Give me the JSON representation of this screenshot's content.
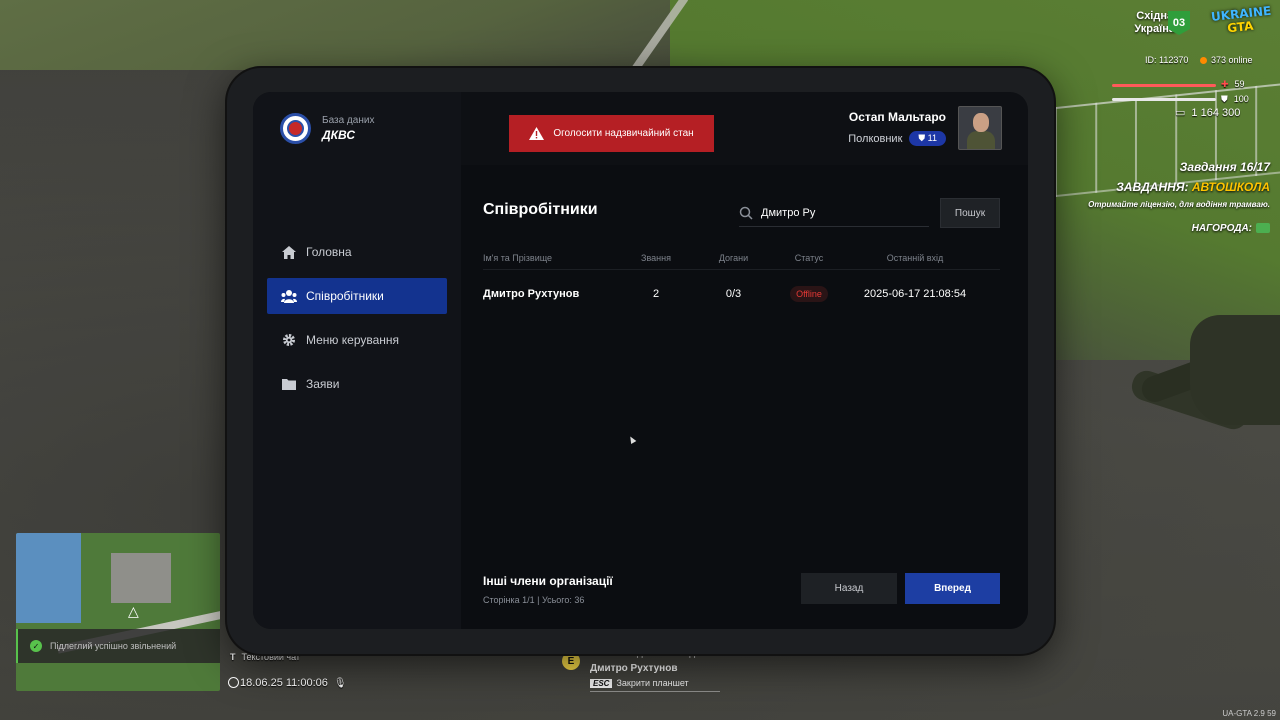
{
  "hud": {
    "region_line1": "Східна",
    "region_line2": "Україна",
    "region_badge": "03",
    "logo_line1": "UKRAINE",
    "logo_line2": "GTA",
    "player_id": "ID: 112370",
    "online": "373 online",
    "health": "59",
    "armor": "100",
    "money": "1 164 300",
    "quest_counter": "Завдання 16/17",
    "quest_prefix": "ЗАВДАННЯ: ",
    "quest_name": "АВТОШКОЛА",
    "quest_desc": "Отримайте ліцензію, для водіння трамваю.",
    "quest_reward": "НАГОРОДА:",
    "accent_color": "#13338f",
    "danger_color": "#b51f24"
  },
  "notifications": {
    "dismissed": "Підлеглий успішно звільнений"
  },
  "chat": {
    "chat_key": "T",
    "chat_label": "Текстовий чат",
    "datetime": "18.06.25 11:00:06"
  },
  "interaction": {
    "key": "E",
    "line1": "Затисніть для взаємодії з",
    "target": "Дмитро Рухтунов",
    "esc_key": "ESC",
    "esc_label": "Закрити планшет"
  },
  "version": "UA-GTA 2.9   59",
  "tablet": {
    "brand_sub": "База даних",
    "brand_name": "ДКВС",
    "emergency_button": "Оголосити надзвичайний стан",
    "user": {
      "name": "Остап Мальтаро",
      "rank": "Полковник",
      "level": "11"
    },
    "nav": [
      {
        "label": "Головна",
        "icon": "home-icon"
      },
      {
        "label": "Співробітники",
        "icon": "users-icon",
        "active": true
      },
      {
        "label": "Меню керування",
        "icon": "gear-icon"
      },
      {
        "label": "Заяви",
        "icon": "folder-icon"
      }
    ],
    "section_title": "Співробітники",
    "search": {
      "value": "Дмитро Ру",
      "button": "Пошук"
    },
    "table": {
      "headers": [
        "Ім'я та Прізвище",
        "Звання",
        "Догани",
        "Статус",
        "Останній вхід"
      ],
      "rows": [
        {
          "name": "Дмитро Рухтунов",
          "rank": "2",
          "warnings": "0/3",
          "status": "Offline",
          "last_login": "2025-06-17 21:08:54"
        }
      ]
    },
    "footer": {
      "title": "Інші члени організації",
      "pagination": "Сторінка 1/1 | Усього: 36",
      "back": "Назад",
      "next": "Вперед"
    }
  }
}
